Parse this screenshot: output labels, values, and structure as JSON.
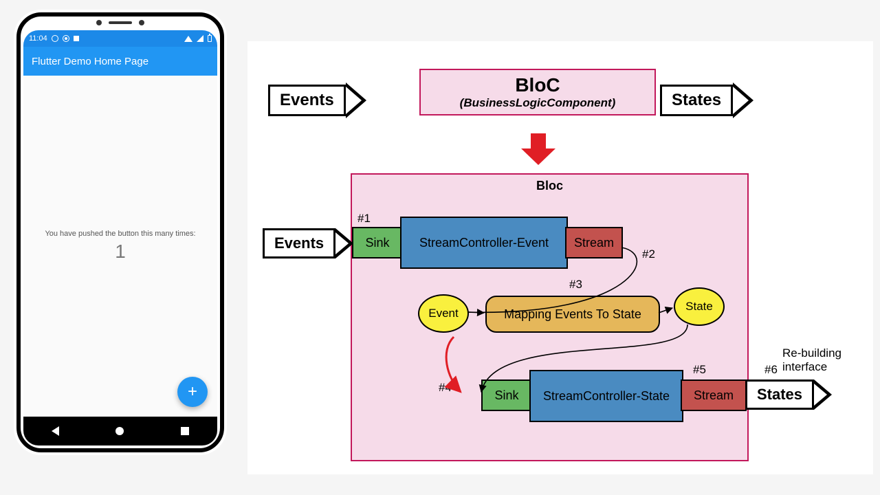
{
  "phone": {
    "status_time": "11:04",
    "appbar_title": "Flutter Demo Home Page",
    "body_text": "You have pushed the button this many times:",
    "counter": "1",
    "fab_label": "+"
  },
  "top": {
    "events_label": "Events",
    "states_label": "States",
    "bloc_title": "BloC",
    "bloc_sub": "(BusinessLogicComponent)"
  },
  "panel": {
    "title": "Bloc",
    "left_events_label": "Events",
    "right_states_label": "States",
    "rebuilding_text": "Re-building\ninterface",
    "step1": "#1",
    "step2": "#2",
    "step3": "#3",
    "step4": "#4",
    "step5": "#5",
    "step6": "#6",
    "sink1": "Sink",
    "sc_event": "StreamController-Event",
    "stream1": "Stream",
    "bubble_event": "Event",
    "mapping": "Mapping Events To State",
    "bubble_state": "State",
    "sink2": "Sink",
    "sc_state": "StreamController-State",
    "stream2": "Stream"
  }
}
